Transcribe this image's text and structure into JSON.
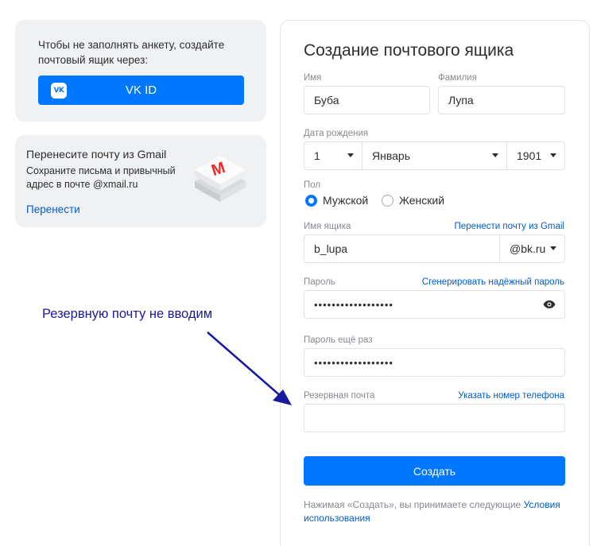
{
  "vk_card": {
    "text": "Чтобы не заполнять анкету, создайте почтовый ящик через:",
    "button_label": "VK ID",
    "logo_text": "VK"
  },
  "gmail_card": {
    "title": "Перенесите почту из Gmail",
    "description": "Сохраните письма и привычный адрес в почте @xmail.ru",
    "link": "Перенести",
    "logo_letter": "M"
  },
  "form": {
    "title": "Создание почтового ящика",
    "first_name": {
      "label": "Имя",
      "value": "Буба"
    },
    "last_name": {
      "label": "Фамилия",
      "value": "Лупа"
    },
    "birth": {
      "label": "Дата рождения",
      "day": "1",
      "month": "Январь",
      "year": "1901"
    },
    "gender": {
      "label": "Пол",
      "male": "Мужской",
      "female": "Женский",
      "selected": "male"
    },
    "mailbox": {
      "label": "Имя ящика",
      "link": "Перенести почту из Gmail",
      "value": "b_lupa",
      "domain": "@bk.ru"
    },
    "password": {
      "label": "Пароль",
      "link": "Сгенерировать надёжный пароль",
      "value": "••••••••••••••••••"
    },
    "password_repeat": {
      "label": "Пароль ещё раз",
      "value": "••••••••••••••••••"
    },
    "backup_email": {
      "label": "Резервная почта",
      "link": "Указать номер телефона",
      "value": ""
    },
    "submit_label": "Создать",
    "terms_text": "Нажимая «Создать», вы принимаете следующие ",
    "terms_link": "Условия использования"
  },
  "annotation": {
    "text": "Резервную почту не вводим",
    "color": "#1a1a9e"
  },
  "colors": {
    "accent": "#0077ff",
    "link": "#005bd1",
    "card_bg": "#f0f1f3"
  }
}
